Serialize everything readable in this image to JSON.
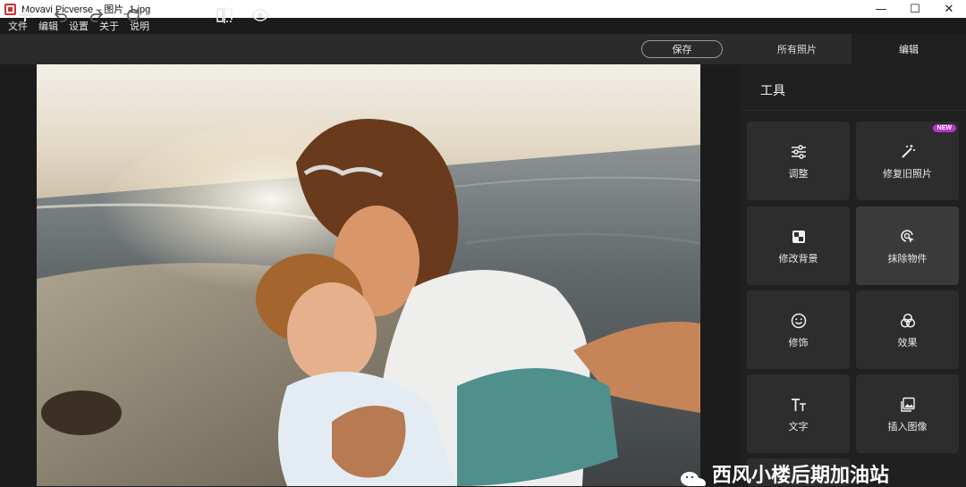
{
  "window": {
    "title": "Movavi Picverse – 图片_1.jpg",
    "controls": {
      "minimize": "—",
      "maximize": "☐",
      "close": "✕"
    }
  },
  "menu": {
    "items": [
      "文件",
      "编辑",
      "设置",
      "关于",
      "说明"
    ]
  },
  "toolbar": {
    "icons": [
      "plus-icon",
      "undo-icon",
      "redo-icon",
      "rotate-icon",
      "compare-icon",
      "eye-icon"
    ],
    "save_label": "保存"
  },
  "tabs": {
    "all_photos": "所有照片",
    "edit": "编辑"
  },
  "panel": {
    "title": "工具",
    "tools": [
      {
        "label": "调整",
        "icon": "sliders-icon",
        "badge": ""
      },
      {
        "label": "修复旧照片",
        "icon": "magic-wand-icon",
        "badge": "NEW"
      },
      {
        "label": "修改背景",
        "icon": "background-icon",
        "badge": ""
      },
      {
        "label": "抹除物件",
        "icon": "eraser-cursor-icon",
        "badge": ""
      },
      {
        "label": "修饰",
        "icon": "smiley-icon",
        "badge": ""
      },
      {
        "label": "效果",
        "icon": "effects-icon",
        "badge": ""
      },
      {
        "label": "文字",
        "icon": "text-icon",
        "badge": ""
      },
      {
        "label": "插入图像",
        "icon": "insert-image-icon",
        "badge": ""
      }
    ]
  },
  "watermark": {
    "text": "西风小楼后期加油站"
  },
  "colors": {
    "accent_badge": "#b535c9",
    "app_red": "#d32f2f"
  }
}
